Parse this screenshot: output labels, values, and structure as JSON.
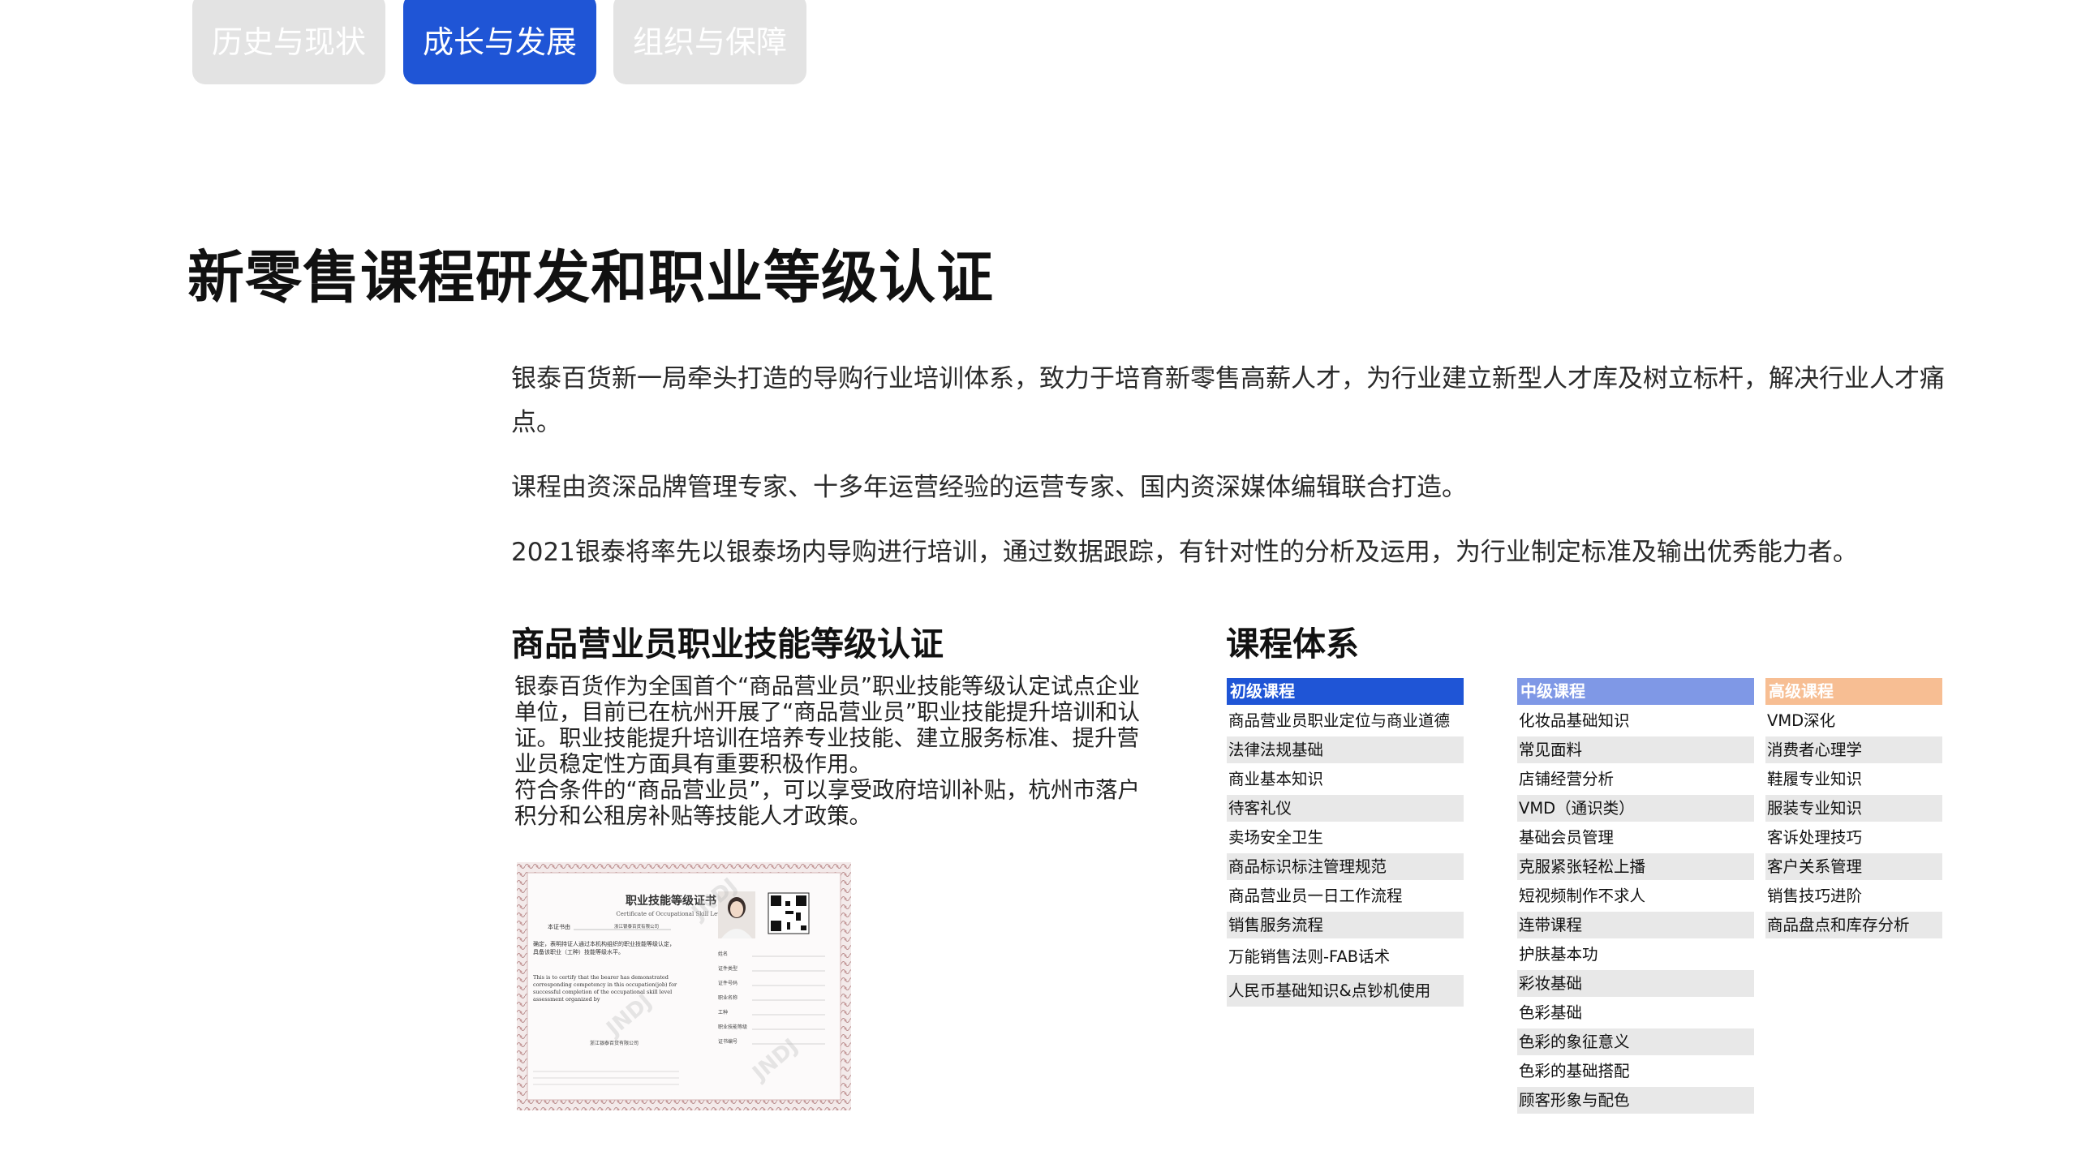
{
  "tabs": [
    {
      "label": "历史与现状",
      "active": false
    },
    {
      "label": "成长与发展",
      "active": true
    },
    {
      "label": "组织与保障",
      "active": false
    }
  ],
  "page_title": "新零售课程研发和职业等级认证",
  "intro": [
    "银泰百货新一局牵头打造的导购行业培训体系，致力于培育新零售高薪人才，为行业建立新型人才库及树立标杆，解决行业人才痛点。",
    "课程由资深品牌管理专家、十多年运营经验的运营专家、国内资深媒体编辑联合打造。",
    "2021银泰将率先以银泰场内导购进行培训，通过数据跟踪，有针对性的分析及运用，为行业制定标准及输出优秀能力者。"
  ],
  "cert_section": {
    "title": "商品营业员职业技能等级认证",
    "paragraphs": [
      "银泰百货作为全国首个“商品营业员”职业技能等级认定试点企业单位，目前已在杭州开展了“商品营业员”职业技能提升培训和认证。职业技能提升培训在培养专业技能、建立服务标准、提升营业员稳定性方面具有重要积极作用。",
      "符合条件的“商品营业员”，可以享受政府培训补贴，杭州市落户积分和公租房补贴等技能人才政策。"
    ],
    "certificate": {
      "title_cn": "职业技能等级证书",
      "title_en": "Certificate of Occupational Skill Level",
      "cert_no_label": "本证书由",
      "body_cn": "确定，表明持证人通过本机构组织的职业技能等级认定，具备该职业（工种）技能等级水平。",
      "body_en": "This is to certify that the bearer has demonstrated corresponding competency in this occupation(job) for successful completion of the occupational skill level assessment organized by",
      "org": "浙江银泰百货有限公司",
      "fields": [
        "姓名",
        "证件类型",
        "证件号码",
        "职业名称",
        "工种",
        "职业技能等级",
        "证书编号"
      ],
      "watermark": "JNDJ"
    }
  },
  "course_section": {
    "title": "课程体系",
    "colors": {
      "primary": "#1f55d6",
      "intermediate": "#7f98e6",
      "advanced": "#f7be93",
      "row_alt": "#e8e8e8"
    },
    "columns": [
      {
        "heading": "初级课程",
        "items": [
          "商品营业员职业定位与商业道德",
          "法律法规基础",
          "商业基本知识",
          "待客礼仪",
          "卖场安全卫生",
          "商品标识标注管理规范",
          "商品营业员一日工作流程",
          "销售服务流程",
          "万能销售法则-FAB话术",
          "人民币基础知识&点钞机使用"
        ]
      },
      {
        "heading": "中级课程",
        "items": [
          "化妆品基础知识",
          "常见面料",
          "店铺经营分析",
          "VMD（通识类）",
          "基础会员管理",
          "克服紧张轻松上播",
          "短视频制作不求人",
          "连带课程",
          "护肤基本功",
          "彩妆基础",
          "色彩基础",
          "色彩的象征意义",
          "色彩的基础搭配",
          "顾客形象与配色"
        ]
      },
      {
        "heading": "高级课程",
        "items": [
          "VMD深化",
          "消费者心理学",
          "鞋履专业知识",
          "服装专业知识",
          "客诉处理技巧",
          "客户关系管理",
          "销售技巧进阶",
          "商品盘点和库存分析"
        ]
      }
    ]
  }
}
